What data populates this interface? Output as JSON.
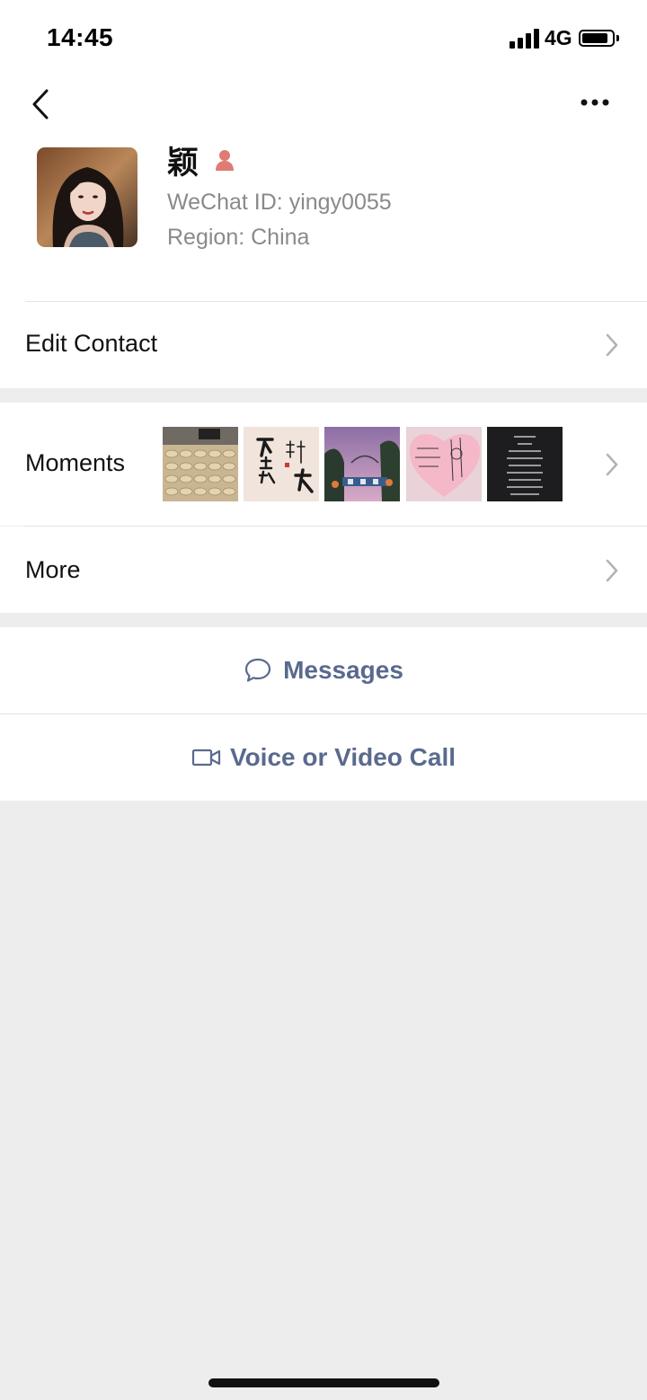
{
  "status_bar": {
    "time": "14:45",
    "network": "4G",
    "battery_level": 0.8
  },
  "nav": {
    "back_icon": "chevron-left-icon",
    "more_icon": "ellipsis-icon"
  },
  "profile": {
    "name": "颖",
    "gender_icon": "female-icon",
    "gender_color": "#e07a74",
    "wechat_id": "WeChat ID: yingy0055",
    "region": "Region: China"
  },
  "menu": {
    "edit_contact": "Edit Contact",
    "moments": "Moments",
    "more": "More"
  },
  "moments_thumbnails": [
    {
      "name": "moment-photo-dumplings"
    },
    {
      "name": "moment-photo-calligraphy"
    },
    {
      "name": "moment-photo-street"
    },
    {
      "name": "moment-photo-heart-note"
    },
    {
      "name": "moment-photo-dark-text"
    }
  ],
  "actions": {
    "messages": "Messages",
    "call": "Voice or Video Call"
  },
  "colors": {
    "accent": "#5a6a8e",
    "background": "#ededed",
    "secondary_text": "#8a8a8a"
  }
}
